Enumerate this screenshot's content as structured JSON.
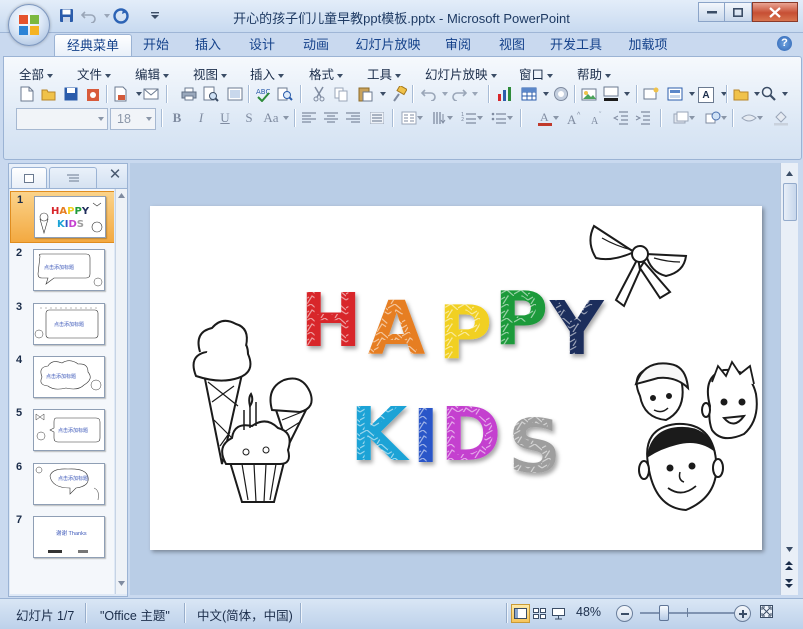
{
  "window": {
    "title": "开心的孩子们儿童早教ppt模板.pptx - Microsoft PowerPoint",
    "quick_access": [
      "save-icon",
      "undo-icon",
      "redo-icon",
      "customize-icon"
    ]
  },
  "ribbon_tabs": [
    "经典菜单",
    "开始",
    "插入",
    "设计",
    "动画",
    "幻灯片放映",
    "审阅",
    "视图",
    "开发工具",
    "加载项"
  ],
  "active_tab": "经典菜单",
  "classic_menu": [
    "全部",
    "文件",
    "编辑",
    "视图",
    "插入",
    "格式",
    "工具",
    "幻灯片放映",
    "窗口",
    "帮助"
  ],
  "format_bar": {
    "font_name_value": "",
    "font_size_value": "18",
    "bold": "B",
    "italic": "I",
    "underline": "U",
    "shadow": "S",
    "change_case": "Aa"
  },
  "left_pane": {
    "tabs": [
      "slides-tab-icon",
      "outline-tab-icon"
    ],
    "close": "✕",
    "slides": [
      {
        "number": "1",
        "selected": true,
        "text": "HAPPY KIDS"
      },
      {
        "number": "2",
        "selected": false,
        "text": "点击添加标题"
      },
      {
        "number": "3",
        "selected": false,
        "text": "点击添加标题"
      },
      {
        "number": "4",
        "selected": false,
        "text": "点击添加标题"
      },
      {
        "number": "5",
        "selected": false,
        "text": "点击添加标题"
      },
      {
        "number": "6",
        "selected": false,
        "text": "点击添加标题"
      },
      {
        "number": "7",
        "selected": false,
        "text": "谢谢 Thanks"
      }
    ]
  },
  "slide": {
    "title_line1": [
      "H",
      "A",
      "P",
      "P",
      "Y"
    ],
    "title_line2": [
      "K",
      "I",
      "D",
      "S"
    ],
    "letter_colors": {
      "H": "#d8262b",
      "A": "#e67e22",
      "P1": "#f1d020",
      "P2": "#1f9a3a",
      "Y": "#1f2d5c",
      "K": "#1ba3d6",
      "I": "#2a56c8",
      "D": "#c43fcf",
      "S": "#9e9e9e"
    },
    "decorations": [
      "ribbon-bow",
      "ice-cream-cones",
      "cupcake",
      "kids-faces"
    ]
  },
  "status_bar": {
    "slide_info": "幻灯片 1/7",
    "theme": "\"Office 主题\"",
    "language": "中文(简体，中国)",
    "zoom": "48%",
    "zoom_level_fraction": 0.48
  },
  "colors": {
    "ribbon_bg": "#dbe7f5",
    "accent": "#15428b",
    "selected_slide": "#f3a941",
    "workspace": "#b9cde6"
  }
}
